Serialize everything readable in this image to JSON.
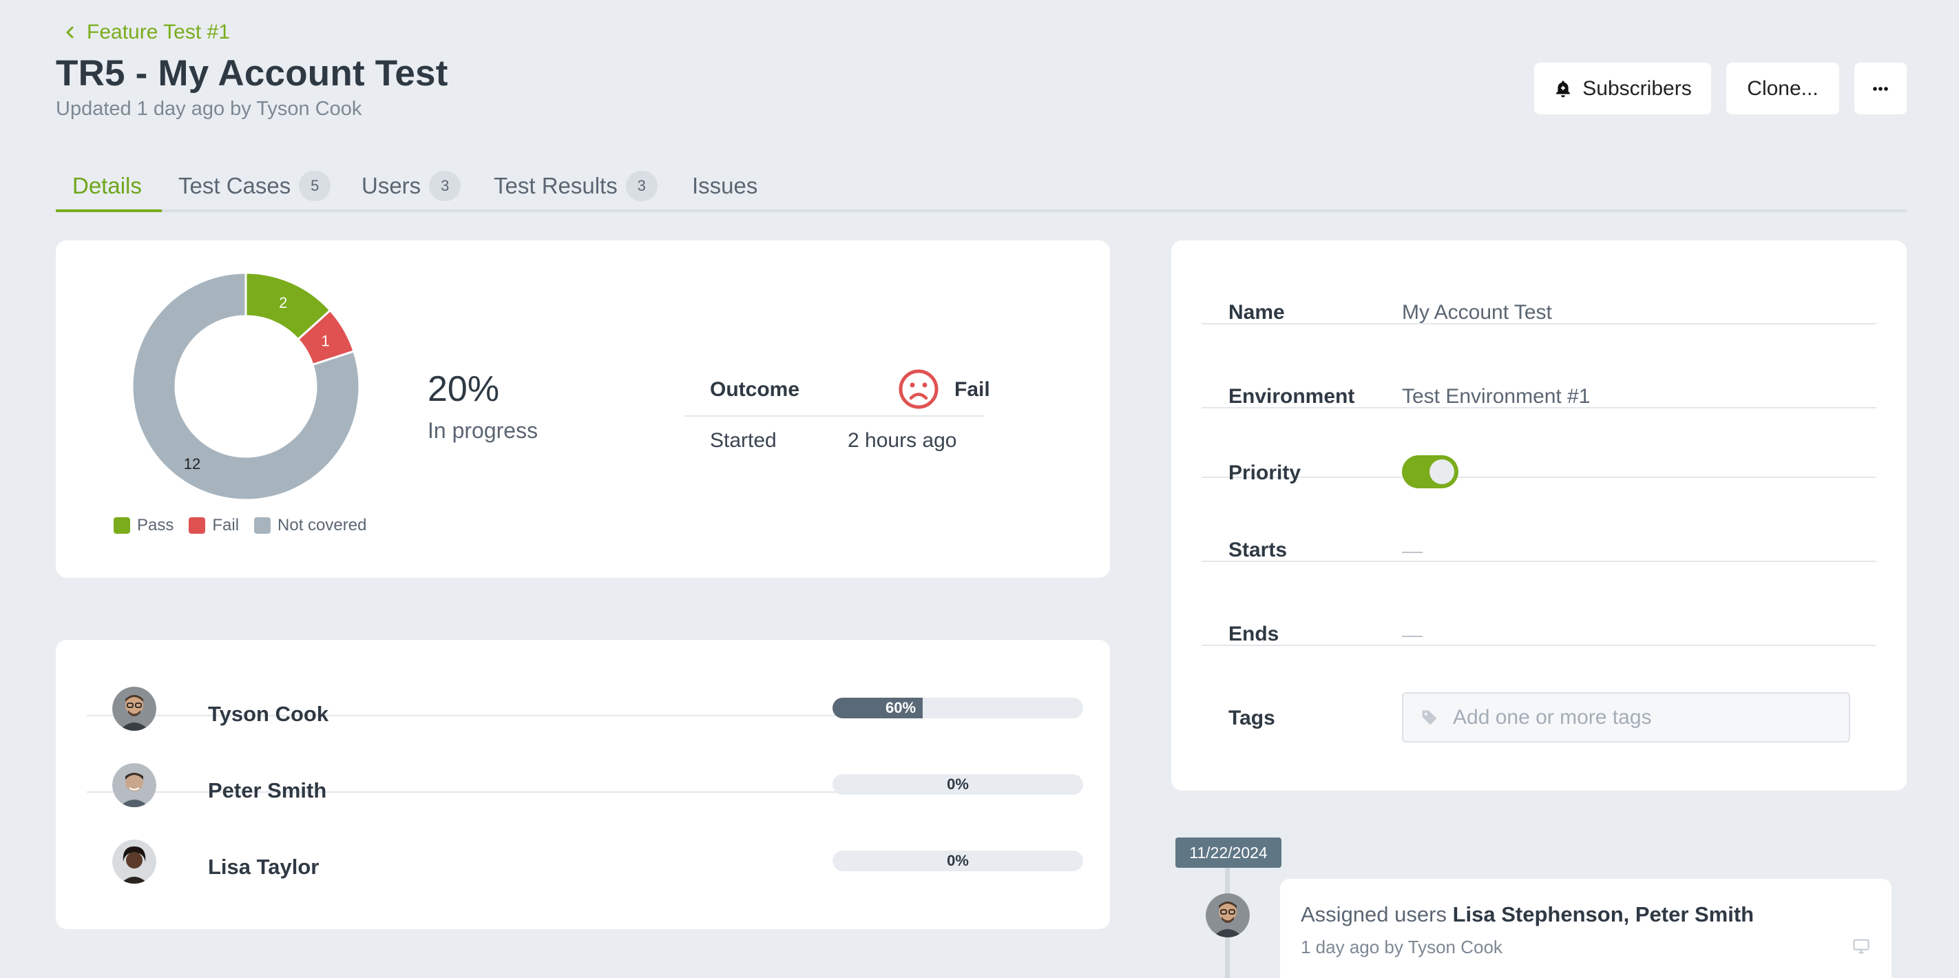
{
  "header": {
    "back_link": "Feature Test #1",
    "title": "TR5 - My Account Test",
    "subtitle": "Updated 1 day ago by Tyson Cook",
    "buttons": {
      "subscribers": "Subscribers",
      "clone": "Clone..."
    }
  },
  "tabs": [
    {
      "label": "Details",
      "active": true
    },
    {
      "label": "Test Cases",
      "count": "5"
    },
    {
      "label": "Users",
      "count": "3"
    },
    {
      "label": "Test Results",
      "count": "3"
    },
    {
      "label": "Issues"
    }
  ],
  "summary": {
    "percent": "20%",
    "status": "In progress",
    "outcome_label": "Outcome",
    "outcome_value": "Fail",
    "started_label": "Started",
    "started_value": "2 hours ago"
  },
  "chart_data": {
    "type": "pie",
    "categories": [
      "Pass",
      "Fail",
      "Not covered"
    ],
    "values": [
      2,
      1,
      12
    ],
    "colors": [
      "#7aac1c",
      "#e05252",
      "#a7b4be"
    ],
    "title": "",
    "legend": "bottom"
  },
  "users": [
    {
      "name": "Tyson Cook",
      "progress": 60,
      "progress_label": "60%"
    },
    {
      "name": "Peter Smith",
      "progress": 0,
      "progress_label": "0%"
    },
    {
      "name": "Lisa Taylor",
      "progress": 0,
      "progress_label": "0%"
    }
  ],
  "properties": {
    "name_label": "Name",
    "name_value": "My Account Test",
    "env_label": "Environment",
    "env_value": "Test Environment #1",
    "priority_label": "Priority",
    "priority_on": true,
    "starts_label": "Starts",
    "ends_label": "Ends",
    "tags_label": "Tags",
    "tags_placeholder": "Add one or more tags"
  },
  "timeline": {
    "date": "11/22/2024",
    "action_prefix": "Assigned users",
    "action_users": "Lisa Stephenson, Peter Smith",
    "meta": "1 day ago by Tyson Cook"
  },
  "colors": {
    "accent": "#7aac1c",
    "fail": "#e05252",
    "neutral": "#a7b4be",
    "background": "#e9edf1"
  }
}
